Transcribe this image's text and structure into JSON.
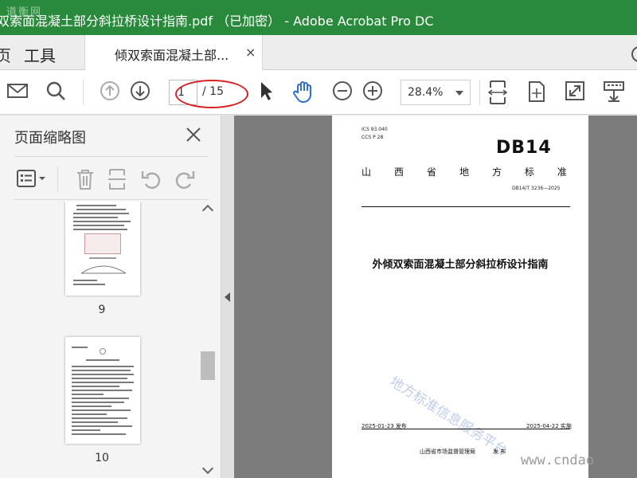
{
  "window": {
    "title": "双索面混凝土部分斜拉桥设计指南.pdf （已加密） - Adobe Acrobat Pro DC",
    "corner_watermark": "道衡网"
  },
  "tabs": {
    "home_label": "页",
    "tools_label": "工具",
    "document_tab_label": "倾双索面混凝土部...",
    "close_glyph": "×"
  },
  "toolbar": {
    "icons": [
      "mail-icon",
      "search-icon",
      "page-up-icon",
      "page-down-icon",
      "select-arrow-icon",
      "hand-icon",
      "zoom-out-icon",
      "zoom-in-icon",
      "fit-page-icon",
      "rotate-page-icon",
      "fullscreen-icon",
      "tools-icon"
    ],
    "current_page": "1",
    "total_pages": "/ 15",
    "zoom": "28.4%"
  },
  "thumbnails_panel": {
    "title": "页面缩略图",
    "pages": [
      {
        "label": "9"
      },
      {
        "label": "10"
      }
    ]
  },
  "document": {
    "ics": "ICS  93.040",
    "ccs": "CCS  P 28",
    "code": "DB14",
    "standard_type": [
      "山",
      "西",
      "省",
      "地",
      "方",
      "标",
      "准"
    ],
    "standard_number": "DB14/T 3236—2025",
    "title": "外倾双索面混凝土部分斜拉桥设计指南",
    "watermark": "地方标准信息服务平台",
    "publish_date": "2025-01-23 发布",
    "implement_date": "2025-04-22 实施",
    "issuer": "山西省市场监督管理局",
    "issue_label": "发  布"
  },
  "site_watermark": "www.cndao",
  "colors": {
    "title_bar": "#2a8a3c",
    "annotation_circle": "#d81e1e",
    "hand_tool": "#2f6fcf"
  }
}
